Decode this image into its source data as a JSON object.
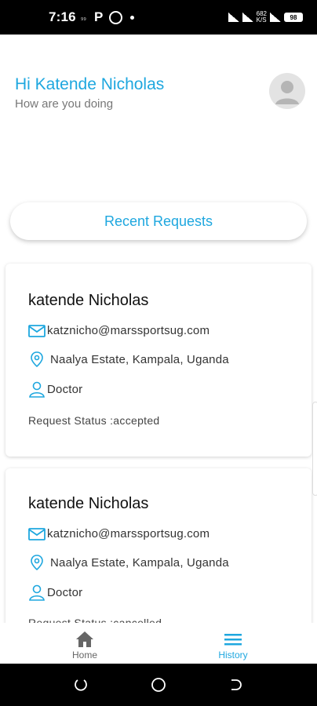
{
  "status_bar": {
    "time": "7:16",
    "small_indicator": "₉",
    "network": "682\nK/S",
    "battery": "98"
  },
  "header": {
    "greeting": "Hi Katende Nicholas",
    "subtitle": "How are you doing"
  },
  "recent_button": "Recent Requests",
  "requests": [
    {
      "name": "katende Nicholas",
      "email": "katznicho@marssportsug.com",
      "location": "Naalya Estate, Kampala, Uganda",
      "role": "Doctor",
      "status": "Request Status :accepted"
    },
    {
      "name": "katende Nicholas",
      "email": "katznicho@marssportsug.com",
      "location": "Naalya Estate, Kampala, Uganda",
      "role": "Doctor",
      "status": "Request Status :cancelled"
    }
  ],
  "bottom_nav": {
    "home": "Home",
    "history": "History",
    "active": "history"
  },
  "colors": {
    "accent": "#1ea7df"
  }
}
